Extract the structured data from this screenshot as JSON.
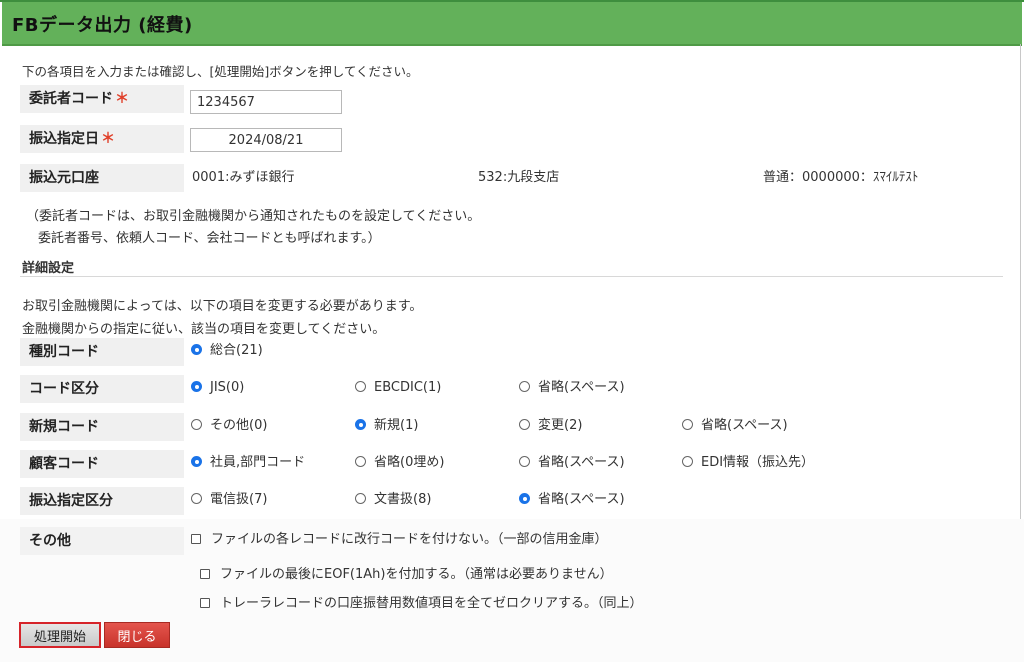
{
  "header": {
    "title": "FBデータ出力 (経費)"
  },
  "intro": "下の各項目を入力または確認し、[処理開始]ボタンを押してください。",
  "fields": {
    "consignor_code": {
      "label": "委託者コード",
      "required_mark": "＊",
      "value": "1234567"
    },
    "transfer_date": {
      "label": "振込指定日",
      "required_mark": "＊",
      "value": "2024/08/21"
    },
    "source_account": {
      "label": "振込元口座",
      "bank": "0001:みずほ銀行",
      "branch": "532:九段支店",
      "account": "普通：0000000：ｽﾏｲﾙﾃｽﾄ"
    }
  },
  "notes": [
    "（委託者コードは、お取引金融機関から通知されたものを設定してください。",
    "委託者番号、依頼人コード、会社コードとも呼ばれます。）"
  ],
  "detail": {
    "title": "詳細設定",
    "desc": [
      "お取引金融機関によっては、以下の項目を変更する必要があります。",
      "金融機関からの指定に従い、該当の項目を変更してください。"
    ]
  },
  "options": {
    "type_code": {
      "label": "種別コード",
      "options": [
        "総合(21)"
      ],
      "selected": 0
    },
    "code_class": {
      "label": "コード区分",
      "options": [
        "JIS(0)",
        "EBCDIC(1)",
        "省略(スペース)"
      ],
      "selected": 0
    },
    "new_code": {
      "label": "新規コード",
      "options": [
        "その他(0)",
        "新規(1)",
        "変更(2)",
        "省略(スペース)"
      ],
      "selected": 1
    },
    "customer_code": {
      "label": "顧客コード",
      "options": [
        "社員,部門コード",
        "省略(0埋め)",
        "省略(スペース)",
        "EDI情報（振込先）"
      ],
      "selected": 0
    },
    "transfer_class": {
      "label": "振込指定区分",
      "options": [
        "電信扱(7)",
        "文書扱(8)",
        "省略(スペース)"
      ],
      "selected": 2
    }
  },
  "other": {
    "label": "その他",
    "checks": [
      {
        "label": "ファイルの各レコードに改行コードを付けない。（一部の信用金庫）",
        "checked": false
      },
      {
        "label": "ファイルの最後にEOF(1Ah)を付加する。（通常は必要ありません）",
        "checked": false
      },
      {
        "label": "トレーラレコードの口座振替用数値項目を全てゼロクリアする。（同上）",
        "checked": false
      }
    ]
  },
  "buttons": {
    "start": "処理開始",
    "close": "閉じる"
  }
}
